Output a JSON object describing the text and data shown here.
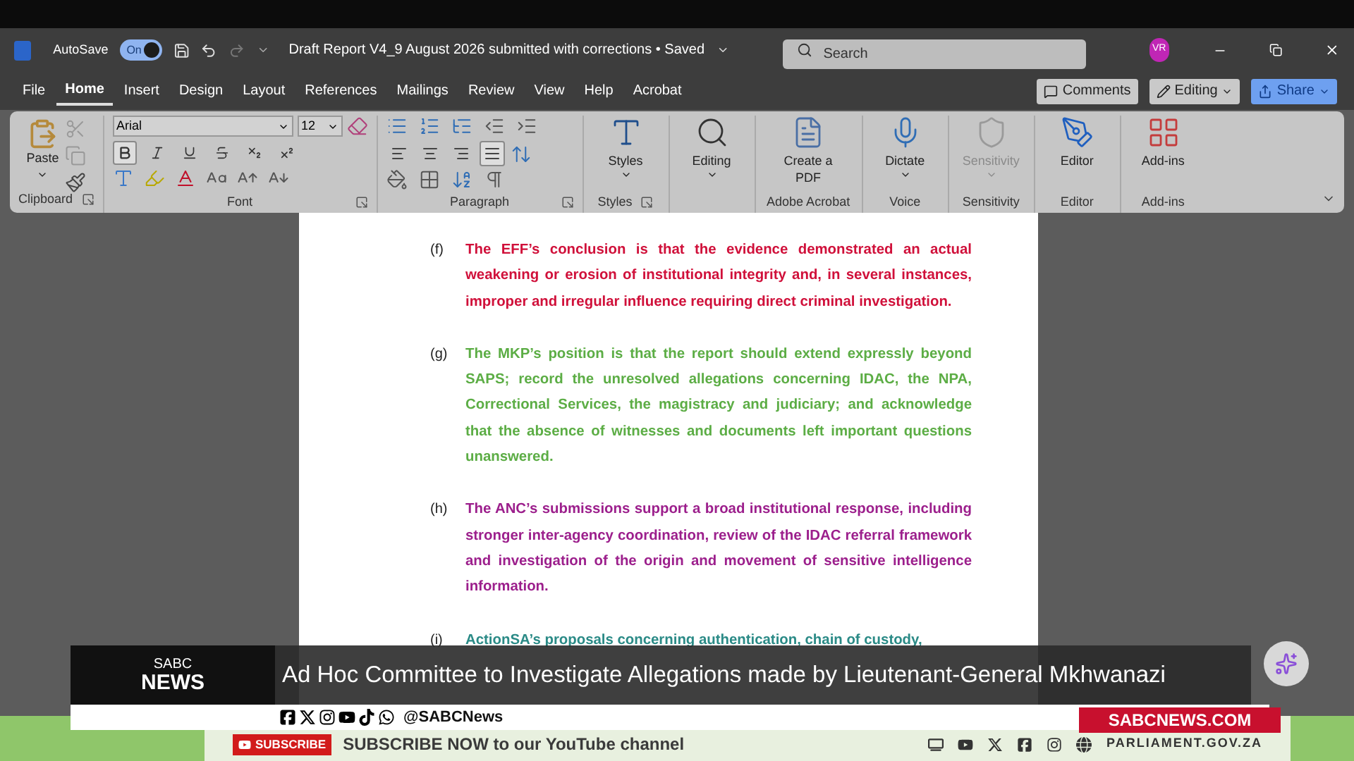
{
  "title_bar": {
    "autosave_label": "AutoSave",
    "autosave": {
      "label": "On",
      "on": true
    },
    "document_title": "Draft Report V4_9 August 2026 submitted with corrections • Saved",
    "search": {
      "placeholder": "Search"
    },
    "avatar": "VR"
  },
  "menu_tabs": [
    {
      "label": "File",
      "selected": false
    },
    {
      "label": "Home",
      "selected": true
    },
    {
      "label": "Insert",
      "selected": false
    },
    {
      "label": "Design",
      "selected": false
    },
    {
      "label": "Layout",
      "selected": false
    },
    {
      "label": "References",
      "selected": false
    },
    {
      "label": "Mailings",
      "selected": false
    },
    {
      "label": "Review",
      "selected": false
    },
    {
      "label": "View",
      "selected": false
    },
    {
      "label": "Help",
      "selected": false
    },
    {
      "label": "Acrobat",
      "selected": false
    }
  ],
  "right_buttons": [
    {
      "kind": "comments",
      "label": "Comments"
    },
    {
      "kind": "editing",
      "label": "Editing"
    },
    {
      "kind": "share",
      "label": "Share"
    }
  ],
  "ribbon": {
    "clipboard": {
      "paste": "Paste",
      "label": "Clipboard"
    },
    "font": {
      "name": "Arial",
      "size": "12",
      "label": "Font",
      "format_buttons": [
        {
          "kind": "bold",
          "selected": true
        },
        {
          "kind": "italic",
          "selected": false
        },
        {
          "kind": "underline",
          "selected": false
        },
        {
          "kind": "strikethrough",
          "selected": false
        },
        {
          "kind": "subscript",
          "selected": false
        },
        {
          "kind": "superscript",
          "selected": false
        }
      ]
    },
    "paragraph": {
      "label": "Paragraph",
      "align_buttons": [
        {
          "kind": "left",
          "selected": false
        },
        {
          "kind": "center",
          "selected": false
        },
        {
          "kind": "right",
          "selected": false
        },
        {
          "kind": "justify",
          "selected": true
        }
      ]
    },
    "big_groups": [
      {
        "kind": "styles",
        "button": "Styles",
        "label": "Styles",
        "disabled": false
      },
      {
        "kind": "editing",
        "button": "Editing",
        "disabled": false
      },
      {
        "kind": "pdf",
        "button": "Create a PDF",
        "label": "Adobe Acrobat",
        "disabled": false
      },
      {
        "kind": "dictate",
        "button": "Dictate",
        "label": "Voice",
        "disabled": false
      },
      {
        "kind": "sensitivity",
        "button": "Sensitivity",
        "label": "Sensitivity",
        "disabled": true
      },
      {
        "kind": "editor",
        "button": "Editor",
        "label": "Editor",
        "disabled": false
      },
      {
        "kind": "addins",
        "button": "Add-ins",
        "label": "Add-ins",
        "disabled": false
      }
    ]
  },
  "document": {
    "paragraphs": [
      {
        "marker": "(f)",
        "color": "#d0103a",
        "text": "The EFF’s conclusion is that the evidence demonstrated an actual weakening or erosion of institutional integrity and, in several instances, improper and irregular influence requiring direct criminal investigation."
      },
      {
        "marker": "(g)",
        "color": "#5cad45",
        "text": "The MKP’s position is that the report should extend expressly beyond SAPS; record the unresolved allegations concerning IDAC, the NPA, Correctional Services, the magistracy and judiciary; and acknowledge that the absence of witnesses and documents left important questions unanswered."
      },
      {
        "marker": "(h)",
        "color": "#9c1f8c",
        "text": "The ANC’s submissions support a broad institutional response, including stronger inter-agency coordination, review of the IDAC referral framework and investigation of the origin and movement of sensitive intelligence information."
      },
      {
        "marker": "(i)",
        "color": "#2a8a86",
        "text": "ActionSA’s proposals concerning authentication, chain of custody,"
      }
    ]
  },
  "news_overlay": {
    "logo_top": "SABC",
    "logo_bottom": "NEWS",
    "headline": "Ad Hoc Committee to Investigate Allegations made by Lieutenant-General Mkhwanazi",
    "handle": "@SABCNews",
    "website": "SABCNEWS.COM"
  },
  "ticker": {
    "subscribe_button": "SUBSCRIBE",
    "text": "SUBSCRIBE NOW to our YouTube channel",
    "site": "PARLIAMENT.GOV.ZA"
  }
}
